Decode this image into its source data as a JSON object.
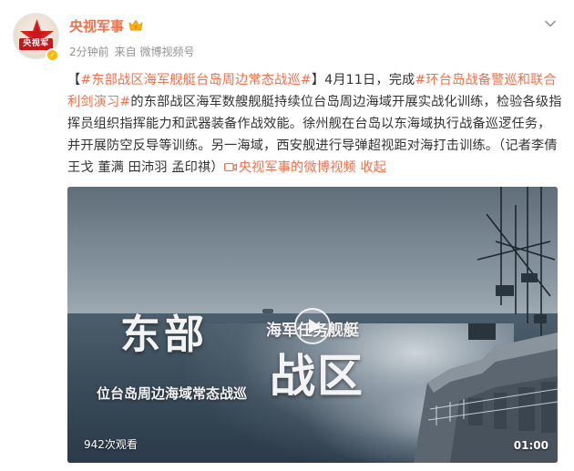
{
  "post": {
    "username": "央视军事",
    "avatar_text": "央视军",
    "time": "2分钟前",
    "source": "来自 微博视频号",
    "content": {
      "bracket_open": "【",
      "topic1": "#东部战区海军舰艇台岛周边常态战巡#",
      "bracket_close": "】",
      "text1": "4月11日，完成",
      "topic2": "#环台岛战备警巡和联合利剑演习#",
      "text2": "的东部战区海军数艘舰艇持续位台岛周边海域开展实战化训练，检验各级指挥员组织指挥能力和武器装备作战效能。徐州舰在台岛以东海域执行战备巡逻任务，并开展防空反导等训练。另一海域，西安舰进行导弹超视距对海打击训练。（记者李倩 王戈 董满 田沛羽 孟印祺）",
      "video_link": "央视军事的微博视频",
      "collapse": "收起"
    },
    "video": {
      "title_main_1": "东部",
      "title_main_2": "战区",
      "title_sub": "海军任务舰艇",
      "caption": "位台岛周边海域常态战巡",
      "views": "942次观看",
      "duration": "01:00"
    }
  },
  "colors": {
    "accent": "#eb7350",
    "brand_red": "#c8161d",
    "verified": "#ffb900",
    "meta_gray": "#939393"
  },
  "icons": {
    "crown": "crown-icon",
    "caret": "chevron-down-icon",
    "verified": "verified-badge-icon",
    "video": "video-camera-icon",
    "play": "play-icon"
  }
}
